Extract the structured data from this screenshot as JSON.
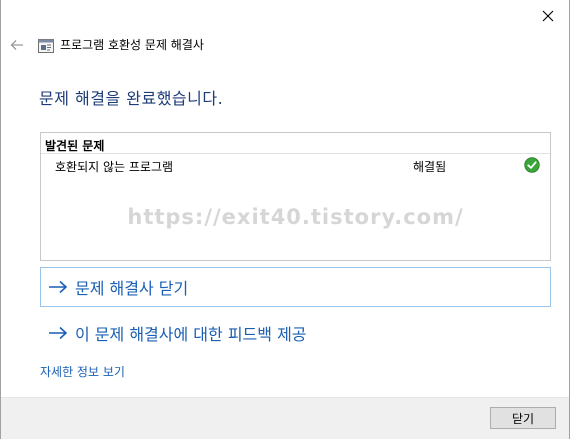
{
  "window": {
    "title": "프로그램 호환성 문제 해결사"
  },
  "heading": "문제 해결을 완료했습니다.",
  "problems": {
    "header": "발견된 문제",
    "rows": [
      {
        "name": "호환되지 않는 프로그램",
        "status": "해결됨",
        "icon": "check-icon",
        "icon_color": "#3aa53a"
      }
    ]
  },
  "watermark": "https://exit40.tistory.com/",
  "links": {
    "close_troubleshooter": "문제 해결사 닫기",
    "feedback": "이 문제 해결사에 대한 피드백 제공",
    "details": "자세한 정보 보기"
  },
  "footer": {
    "close_button": "닫기"
  },
  "colors": {
    "heading": "#1e3c78",
    "link": "#1a5fb4",
    "primary_border": "#9ac4ea",
    "footer_bg": "#f0f0f0"
  }
}
